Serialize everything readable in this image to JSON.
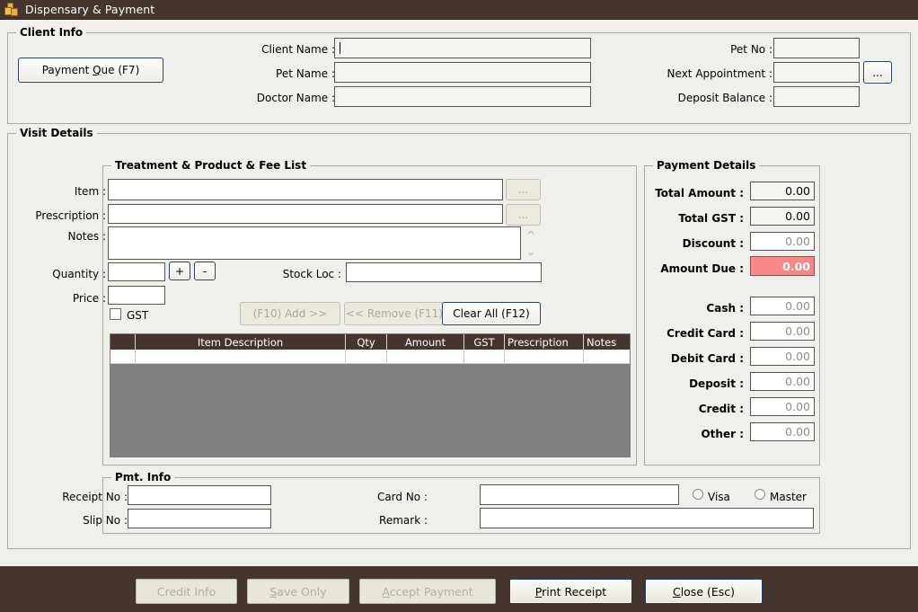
{
  "window": {
    "title": "Dispensary & Payment",
    "icon": "coins-icon"
  },
  "client_info": {
    "legend": "Client Info",
    "payment_que_button": "Payment Que (F7)",
    "payment_que_accel": "Q",
    "fields": {
      "client_name_label": "Client Name :",
      "client_name_value": "",
      "pet_name_label": "Pet Name :",
      "pet_name_value": "",
      "doctor_name_label": "Doctor Name :",
      "doctor_name_value": "",
      "pet_no_label": "Pet No :",
      "pet_no_value": "",
      "next_appointment_label": "Next Appointment :",
      "next_appointment_value": "",
      "next_appointment_browse": "...",
      "deposit_balance_label": "Deposit Balance :",
      "deposit_balance_value": ""
    }
  },
  "visit_details": {
    "legend": "Visit Details"
  },
  "treatment": {
    "legend": "Treatment & Product & Fee List",
    "item_label": "Item :",
    "item_value": "",
    "item_browse": "...",
    "prescription_label": "Prescription :",
    "prescription_value": "",
    "prescription_browse": "...",
    "notes_label": "Notes :",
    "notes_value": "",
    "quantity_label": "Quantity :",
    "quantity_value": "",
    "plus_button": "+",
    "minus_button": "-",
    "stock_loc_label": "Stock Loc :",
    "stock_loc_value": "",
    "price_label": "Price :",
    "price_value": "",
    "gst_checkbox_label": "GST",
    "add_button": "(F10) Add >>",
    "remove_button": "<< Remove (F11)",
    "clear_all_button": "Clear All (F12)"
  },
  "grid": {
    "columns": [
      "",
      "Item Description",
      "Qty",
      "Amount",
      "GST",
      "Prescription",
      "Notes"
    ],
    "rows": [
      [
        "",
        "",
        "",
        "",
        "",
        "",
        ""
      ]
    ]
  },
  "payment_details": {
    "legend": "Payment Details",
    "rows": [
      {
        "label": "Total Amount :",
        "value": "0.00",
        "style": "readonly",
        "bold": true
      },
      {
        "label": "Total GST :",
        "value": "0.00",
        "style": "readonly",
        "bold": true
      },
      {
        "label": "Discount :",
        "value": "0.00",
        "style": "editable",
        "bold": true
      },
      {
        "label": "Amount Due :",
        "value": "0.00",
        "style": "due",
        "bold": true
      }
    ],
    "tender_rows": [
      {
        "label": "Cash :",
        "value": "0.00"
      },
      {
        "label": "Credit Card :",
        "value": "0.00"
      },
      {
        "label": "Debit Card :",
        "value": "0.00"
      },
      {
        "label": "Deposit :",
        "value": "0.00"
      },
      {
        "label": "Credit :",
        "value": "0.00"
      },
      {
        "label": "Other :",
        "value": "0.00"
      }
    ]
  },
  "pmt_info": {
    "legend": "Pmt. Info",
    "receipt_no_label": "Receipt No :",
    "receipt_no_value": "",
    "slip_no_label": "Slip No :",
    "slip_no_value": "",
    "card_no_label": "Card No :",
    "card_no_value": "",
    "remark_label": "Remark :",
    "remark_value": "",
    "visa_label": "Visa",
    "master_label": "Master"
  },
  "footer": {
    "credit_info": "Credit Info",
    "save_only": "Save Only",
    "save_only_accel": "S",
    "accept_payment": "Accept Payment",
    "accept_payment_accel": "A",
    "print_receipt": "Print Receipt",
    "print_receipt_accel": "P",
    "close": "Close (Esc)",
    "close_accel": "C"
  },
  "colors": {
    "chrome": "#46352f",
    "surface": "#efefeb",
    "grid_body": "#808080",
    "amount_due": "#f98787",
    "field": "#f4f4f2"
  }
}
